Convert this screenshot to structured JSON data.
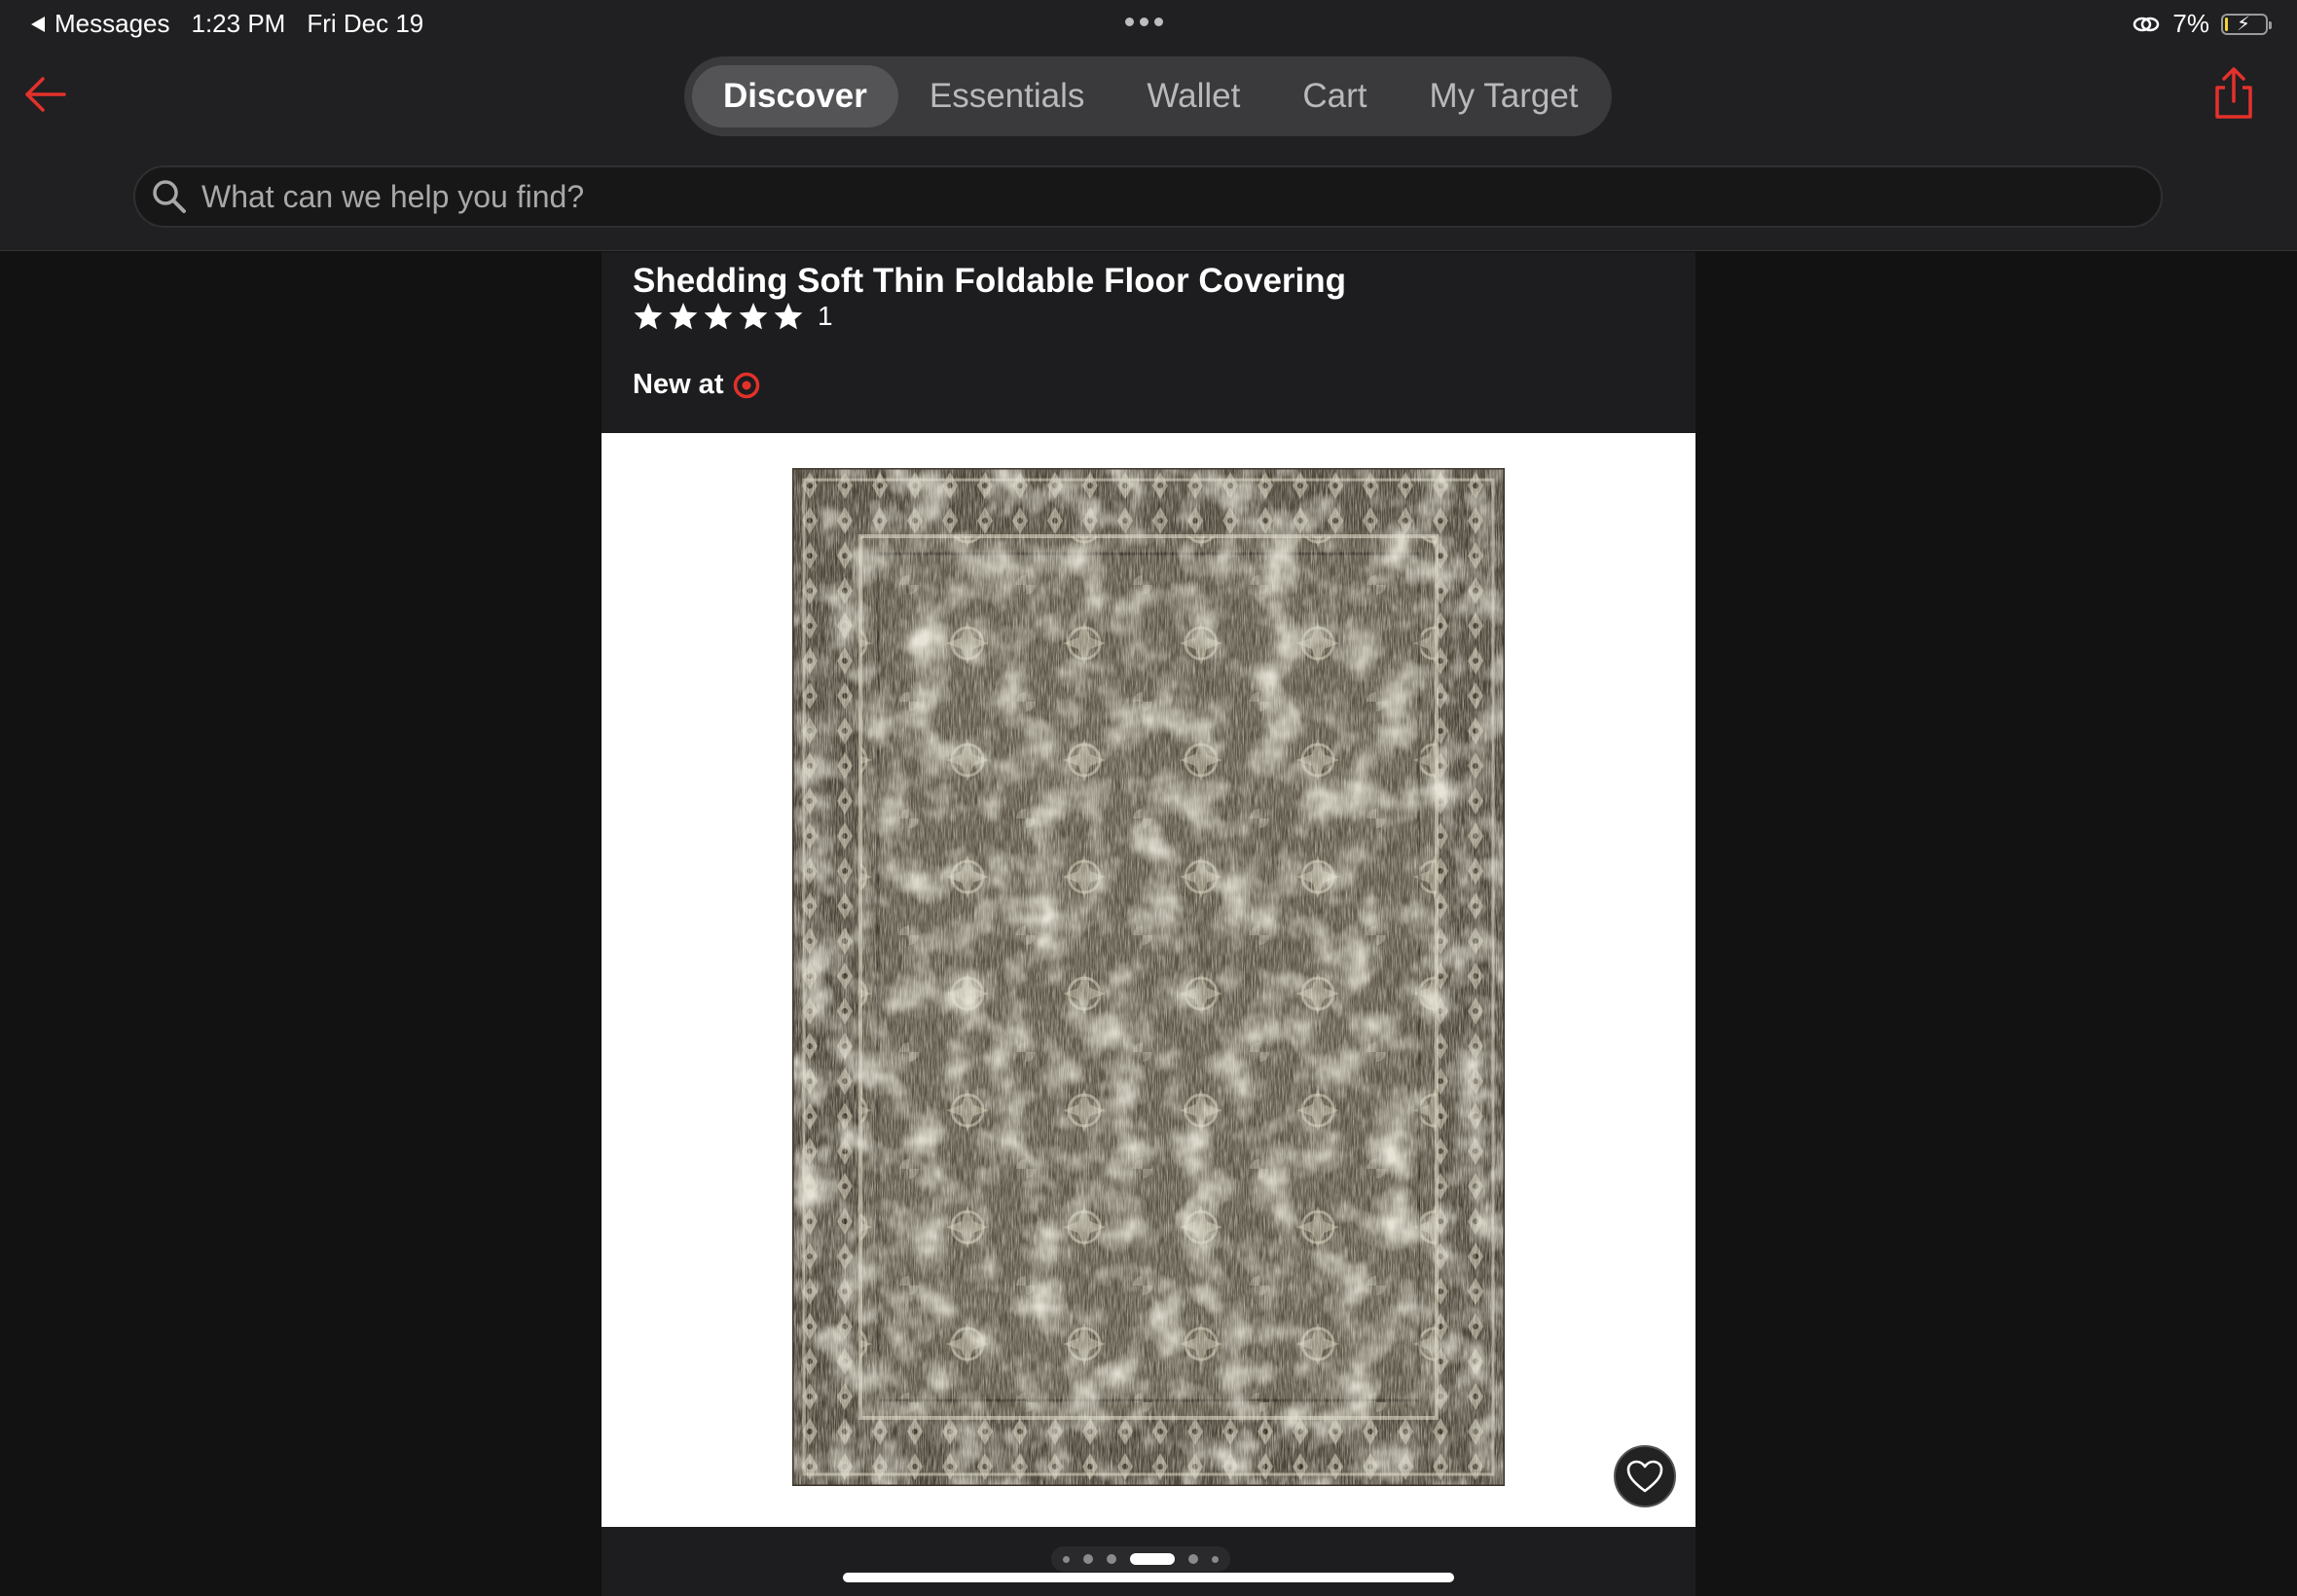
{
  "status_bar": {
    "back_app": "Messages",
    "time": "1:23 PM",
    "date": "Fri Dec 19",
    "battery": "7%",
    "battery_level": 0.07
  },
  "nav": {
    "tabs": [
      {
        "label": "Discover",
        "active": true
      },
      {
        "label": "Essentials",
        "active": false
      },
      {
        "label": "Wallet",
        "active": false
      },
      {
        "label": "Cart",
        "active": false
      },
      {
        "label": "My Target",
        "active": false
      }
    ],
    "search_placeholder": "What can we help you find?"
  },
  "product": {
    "title": "Shedding Soft Thin Foldable Floor Covering",
    "rating_stars": 5,
    "rating_count": "1",
    "new_at_label": "New at",
    "image_pager": {
      "count": 6,
      "active_index": 3
    }
  },
  "colors": {
    "accent": "#e4312b",
    "background": "#121212",
    "panel": "#1d1d1f"
  },
  "icons": {
    "back": "back-arrow-icon",
    "share": "share-icon",
    "search": "search-icon",
    "favorite": "heart-icon",
    "brand": "target-bullseye-icon"
  }
}
